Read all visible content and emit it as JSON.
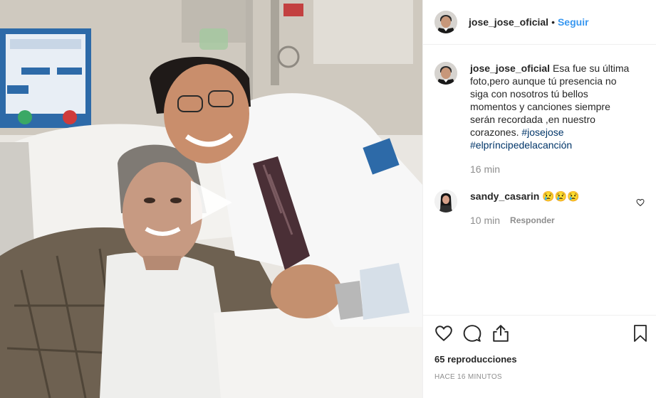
{
  "post": {
    "username": "jose_jose_oficial",
    "separator": "•",
    "follow_label": "Seguir"
  },
  "caption": {
    "username": "jose_jose_oficial",
    "text": "Esa fue su última foto,pero aunque tú presencia no siga con nosotros tú bellos momentos y canciones siempre serán recordada ,en nuestro corazones.",
    "hashtags": [
      "#josejose",
      "#elpríncipedelacanción"
    ],
    "time": "16 min"
  },
  "comments": [
    {
      "username": "sandy_casarin",
      "text": "😢😢😢",
      "time": "10 min",
      "reply_label": "Responder"
    }
  ],
  "stats": {
    "views": "65 reproducciones",
    "posted": "HACE 16 MINUTOS"
  },
  "icons": {
    "like": "heart-icon",
    "comment": "comment-icon",
    "share": "share-icon",
    "save": "bookmark-icon",
    "play": "play-icon"
  },
  "colors": {
    "link": "#3897f0",
    "hashtag": "#003569",
    "muted": "#8e8e8e",
    "text": "#262626",
    "border": "#efefef"
  }
}
